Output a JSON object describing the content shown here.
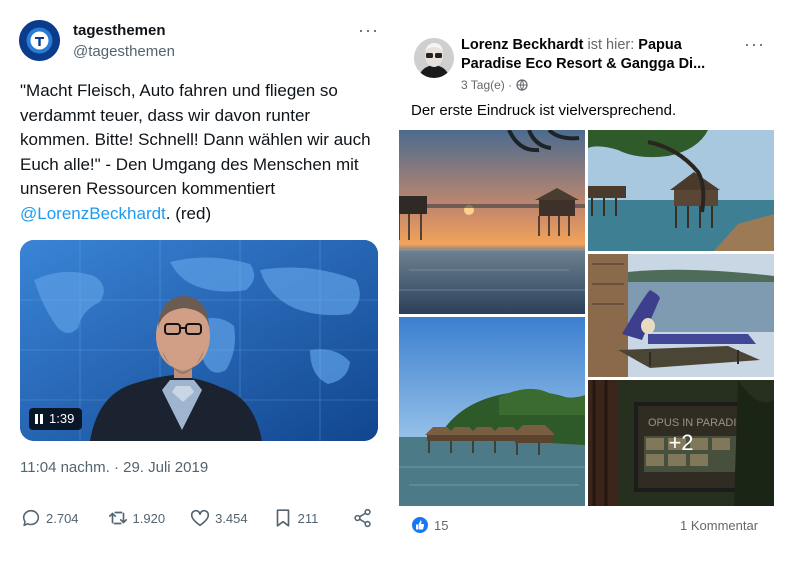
{
  "tweet": {
    "display_name": "tagesthemen",
    "handle": "@tagesthemen",
    "more_label": "···",
    "text_main": "\"Macht Fleisch, Auto fahren und fliegen so verdammt teuer, dass wir davon runter kommen. Bitte! Schnell! Dann wählen wir auch Euch alle!\" - Den Umgang des Menschen mit unseren Ressourcen kommentiert ",
    "mention": "@LorenzBeckhardt",
    "text_tail": ". (red)",
    "video_time": "1:39",
    "timestamp": "11:04 nachm. · 29. Juli 2019",
    "replies": "2.704",
    "retweets": "1.920",
    "likes": "3.454",
    "bookmarks": "211",
    "colors": {
      "accent": "#1d9bf0",
      "muted": "#536471"
    }
  },
  "fb": {
    "author": "Lorenz Beckhardt",
    "is_here": "ist hier:",
    "place": "Papua Paradise Eco Resort & Gangga Di...",
    "time": "3 Tag(e) ·",
    "more_label": "···",
    "text": "Der erste Eindruck ist vielversprechend.",
    "more_photos": "+2",
    "sign_text": "OPUS IN PARADISE",
    "likes_count": "15",
    "comments": "1 Kommentar",
    "colors": {
      "like": "#1877f2",
      "muted": "#65676b"
    }
  }
}
